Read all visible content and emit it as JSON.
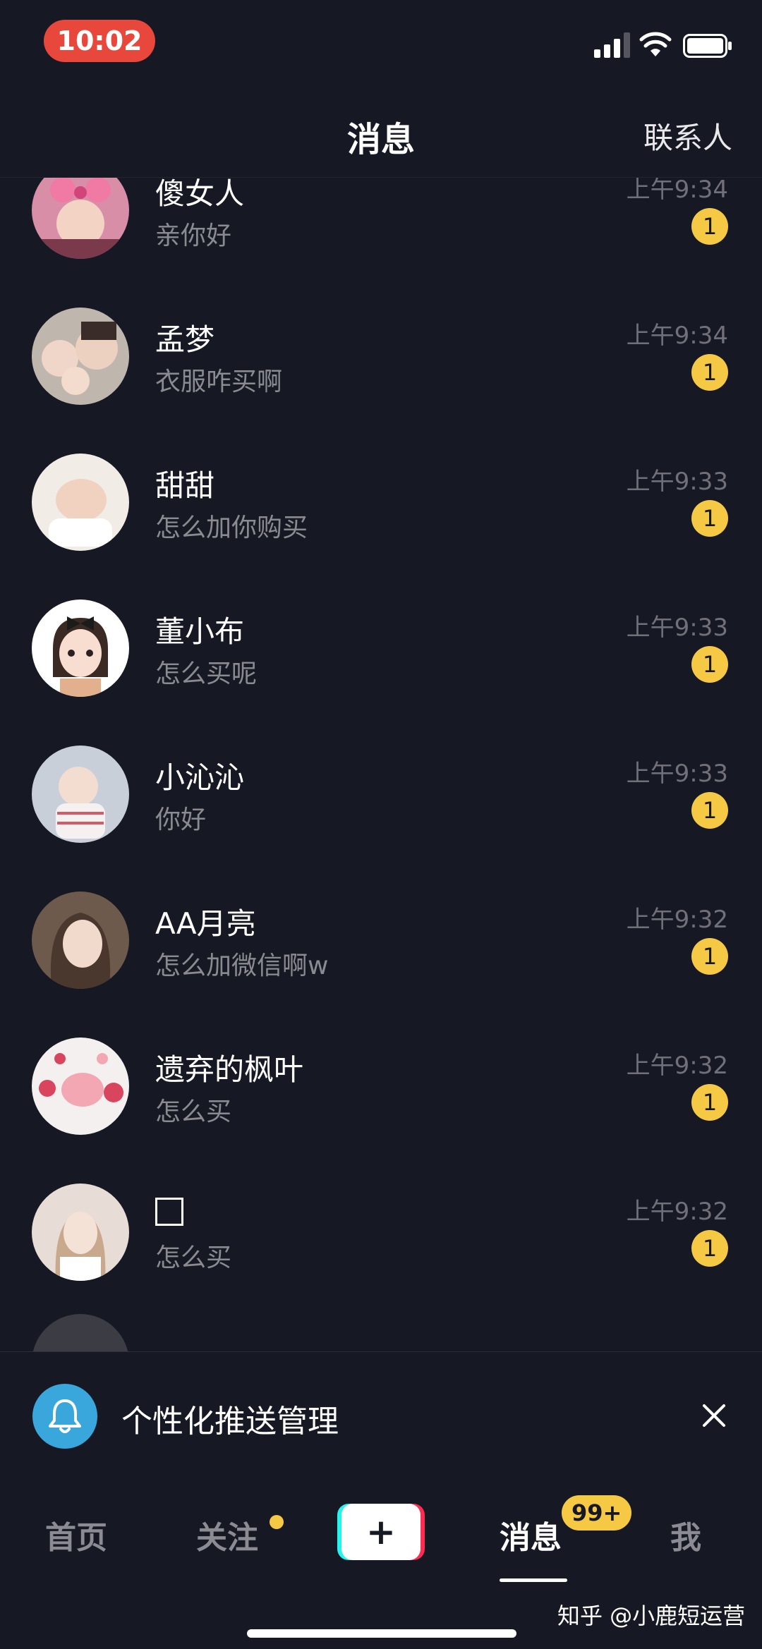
{
  "status_bar": {
    "time": "10:02"
  },
  "header": {
    "title": "消息",
    "contacts_label": "联系人"
  },
  "messages": [
    {
      "name": "傻女人",
      "preview": "亲你好",
      "time": "上午9:34",
      "unread": "1"
    },
    {
      "name": "孟梦",
      "preview": "衣服咋买啊",
      "time": "上午9:34",
      "unread": "1"
    },
    {
      "name": "甜甜",
      "preview": "怎么加你购买",
      "time": "上午9:33",
      "unread": "1"
    },
    {
      "name": "董小布",
      "preview": "怎么买呢",
      "time": "上午9:33",
      "unread": "1"
    },
    {
      "name": "小沁沁",
      "preview": "你好",
      "time": "上午9:33",
      "unread": "1"
    },
    {
      "name": "AA月亮",
      "preview": "怎么加微信啊w",
      "time": "上午9:32",
      "unread": "1"
    },
    {
      "name": "遗弃的枫叶",
      "preview": "怎么买",
      "time": "上午9:32",
      "unread": "1"
    },
    {
      "name": "",
      "preview": "怎么买",
      "time": "上午9:32",
      "unread": "1"
    }
  ],
  "push_banner": {
    "text": "个性化推送管理"
  },
  "tab_bar": {
    "home": "首页",
    "follow": "关注",
    "create": "+",
    "messages": "消息",
    "messages_badge": "99+",
    "me": "我"
  },
  "watermark": "知乎 @小鹿短运营",
  "colors": {
    "background": "#161823",
    "accent_yellow": "#f6c945",
    "bell_blue": "#3aa7dc",
    "time_pill": "#e8473b"
  }
}
